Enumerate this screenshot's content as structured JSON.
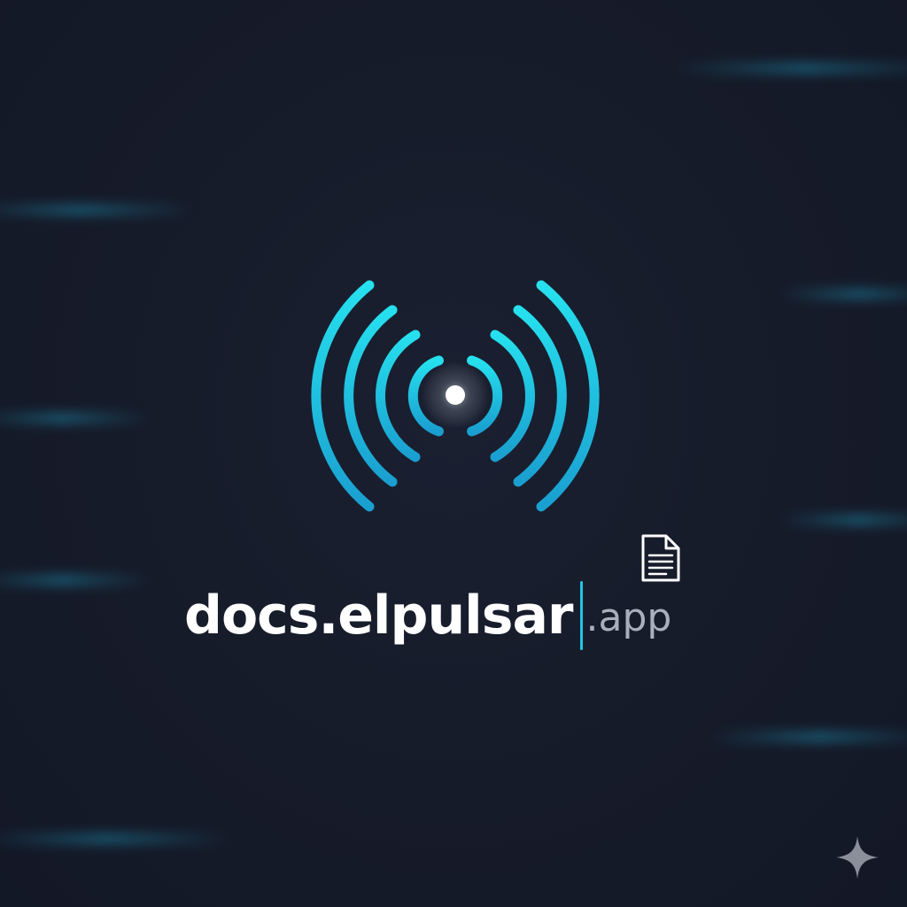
{
  "wordmark": {
    "brand": "docs.elpulsar",
    "tld": ".app"
  },
  "icons": {
    "logo": "pulse-signal-icon",
    "document": "document-icon",
    "sparkle": "sparkle-icon"
  },
  "colors": {
    "background": "#161b29",
    "accent": "#22c4e6",
    "accent_deep": "#1a9fd0",
    "text_primary": "#ffffff",
    "text_secondary": "#a9afbb"
  }
}
